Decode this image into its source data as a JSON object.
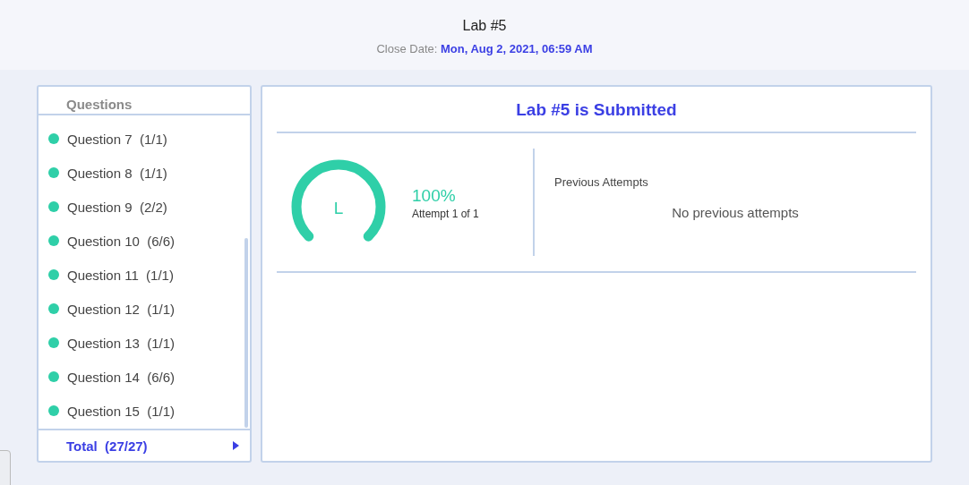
{
  "header": {
    "title": "Lab #5",
    "close_label": "Close Date:",
    "close_date": "Mon, Aug 2, 2021, 06:59 AM"
  },
  "sidebar": {
    "heading": "Questions",
    "items": [
      {
        "label": "Question 7  (1/1)",
        "color": "#2fcfa8"
      },
      {
        "label": "Question 8  (1/1)",
        "color": "#2fcfa8"
      },
      {
        "label": "Question 9  (2/2)",
        "color": "#2fcfa8"
      },
      {
        "label": "Question 10  (6/6)",
        "color": "#2fcfa8"
      },
      {
        "label": "Question 11  (1/1)",
        "color": "#2fcfa8"
      },
      {
        "label": "Question 12  (1/1)",
        "color": "#2fcfa8"
      },
      {
        "label": "Question 13  (1/1)",
        "color": "#2fcfa8"
      },
      {
        "label": "Question 14  (6/6)",
        "color": "#2fcfa8"
      },
      {
        "label": "Question 15  (1/1)",
        "color": "#2fcfa8"
      }
    ],
    "total": "Total  (27/27)"
  },
  "result": {
    "title": "Lab #5 is Submitted",
    "gauge": {
      "letter": "L",
      "level": 1
    },
    "score": "100%",
    "attempt": "Attempt 1 of 1",
    "previous_heading": "Previous Attempts",
    "previous_empty": "No previous attempts"
  }
}
